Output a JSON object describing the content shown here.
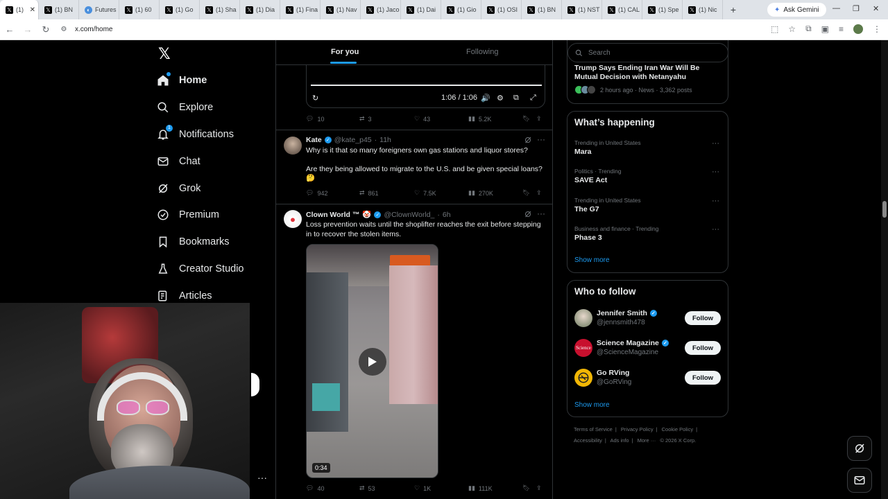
{
  "browser": {
    "tabs": [
      {
        "label": "(1)",
        "icon": "x-icon",
        "active": true
      },
      {
        "label": "(1) BN",
        "icon": "x-icon"
      },
      {
        "label": "Futures",
        "icon": "globe-icon"
      },
      {
        "label": "(1) 60",
        "icon": "x-icon"
      },
      {
        "label": "(1) Go",
        "icon": "x-icon"
      },
      {
        "label": "(1) Sha",
        "icon": "x-icon"
      },
      {
        "label": "(1) Dia",
        "icon": "x-icon"
      },
      {
        "label": "(1) Fina",
        "icon": "x-icon"
      },
      {
        "label": "(1) Nav",
        "icon": "x-icon"
      },
      {
        "label": "(1) Jaco",
        "icon": "x-icon"
      },
      {
        "label": "(1) Dai",
        "icon": "x-icon"
      },
      {
        "label": "(1) Gio",
        "icon": "x-icon"
      },
      {
        "label": "(1) OSI",
        "icon": "x-icon"
      },
      {
        "label": "(1) BN",
        "icon": "x-icon"
      },
      {
        "label": "(1) NST",
        "icon": "x-icon"
      },
      {
        "label": "(1) CAL",
        "icon": "x-icon"
      },
      {
        "label": "(1) Spe",
        "icon": "x-icon"
      },
      {
        "label": "(1) Nic",
        "icon": "x-icon"
      }
    ],
    "ask_gemini": "Ask Gemini",
    "url": "x.com/home"
  },
  "nav": {
    "items": [
      {
        "label": "Home",
        "icon": "home-icon"
      },
      {
        "label": "Explore",
        "icon": "search-icon"
      },
      {
        "label": "Notifications",
        "icon": "bell-icon",
        "badge": "1"
      },
      {
        "label": "Chat",
        "icon": "mail-icon"
      },
      {
        "label": "Grok",
        "icon": "grok-icon"
      },
      {
        "label": "Premium",
        "icon": "verified-icon"
      },
      {
        "label": "Bookmarks",
        "icon": "bookmark-icon"
      },
      {
        "label": "Creator Studio",
        "icon": "flask-icon"
      },
      {
        "label": "Articles",
        "icon": "article-icon"
      }
    ]
  },
  "feed": {
    "tabs": {
      "for_you": "For you",
      "following": "Following"
    },
    "video_time": "1:06 / 1:06",
    "tweets": [
      {
        "replies": "10",
        "reposts": "3",
        "likes": "43",
        "views": "5.2K"
      },
      {
        "name": "Kate",
        "handle": "@kate_p45",
        "time": "11h",
        "text1": "Why is it that so many foreigners own gas stations and liquor stores?",
        "text2": "Are they being allowed to migrate to the U.S. and be given special loans?",
        "emoji": "🤔",
        "replies": "942",
        "reposts": "861",
        "likes": "7.5K",
        "views": "270K"
      },
      {
        "name": "Clown World ™",
        "emoji_name": "🤡",
        "handle": "@ClownWorld_",
        "time": "6h",
        "text": "Loss prevention waits until the shoplifter reaches the exit before stepping in to recover the stolen items.",
        "video_duration": "0:34",
        "replies": "40",
        "reposts": "53",
        "likes": "1K",
        "views": "111K"
      }
    ]
  },
  "sidebar": {
    "search_placeholder": "Search",
    "news": {
      "title": "Trump Says Ending Iran War Will Be Mutual Decision with Netanyahu",
      "meta": "2 hours ago · News · 3,362 posts"
    },
    "happening": {
      "title": "What’s happening",
      "trends": [
        {
          "context": "Trending in United States",
          "name": "Mara"
        },
        {
          "context": "Politics · Trending",
          "name": "SAVE Act"
        },
        {
          "context": "Trending in United States",
          "name": "The G7"
        },
        {
          "context": "Business and finance · Trending",
          "name": "Phase 3"
        }
      ],
      "show_more": "Show more"
    },
    "who_to_follow": {
      "title": "Who to follow",
      "users": [
        {
          "name": "Jennifer Smith",
          "handle": "@jennsmith478",
          "verified": true,
          "follow": "Follow"
        },
        {
          "name": "Science Magazine",
          "handle": "@ScienceMagazine",
          "verified": true,
          "follow": "Follow",
          "avatar_text": "Science"
        },
        {
          "name": "Go RVing",
          "handle": "@GoRVing",
          "verified": false,
          "follow": "Follow"
        }
      ],
      "show_more": "Show more"
    },
    "footer": [
      "Terms of Service",
      "|",
      "Privacy Policy",
      "|",
      "Cookie Policy",
      "|",
      "Accessibility",
      "|",
      "Ads info",
      "|",
      "More ···",
      "© 2026 X Corp."
    ]
  },
  "colors": {
    "accent": "#1d9bf0",
    "background": "#000000",
    "border": "#2f3336",
    "muted": "#71767b"
  }
}
